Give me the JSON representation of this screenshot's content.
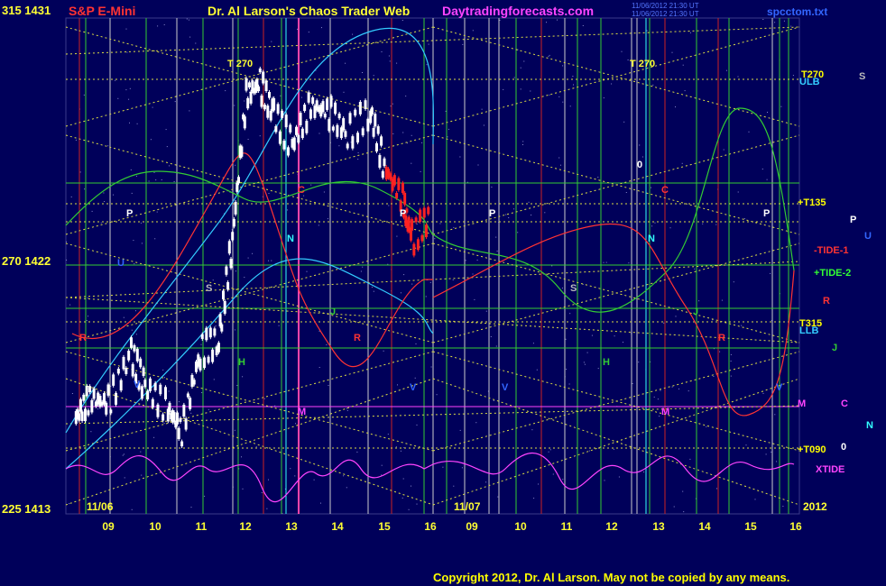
{
  "header": {
    "left_price": "315 1431",
    "symbol": "S&P E-Mini",
    "brand": "Dr. Al Larson's Chaos Trader Web",
    "site": "Daytradingforecasts.com",
    "stamp_1": "11/06/2012 21:30 UT",
    "stamp_2": "11/06/2012 21:30 UT",
    "file": "spcctom.txt"
  },
  "left_axis": {
    "top": "315 1431",
    "middle": "270 1422",
    "bottom": "225 1413"
  },
  "right_labels": [
    {
      "text": "T270",
      "color": "#ffff00"
    },
    {
      "text": "ULB",
      "color": "#33ccff"
    },
    {
      "text": "S",
      "color": "#bbbbbb"
    },
    {
      "text": "+T135",
      "color": "#ffff00"
    },
    {
      "text": "P",
      "color": "#ffffff"
    },
    {
      "text": "U",
      "color": "#3366ff"
    },
    {
      "text": "-TIDE-1",
      "color": "#ff3333"
    },
    {
      "text": "+TIDE-2",
      "color": "#33ff33"
    },
    {
      "text": "R",
      "color": "#ff3333"
    },
    {
      "text": "T315",
      "color": "#ffff00"
    },
    {
      "text": "LLB",
      "color": "#33ccff"
    },
    {
      "text": "J",
      "color": "#33cc33"
    },
    {
      "text": "M",
      "color": "#ff44ff"
    },
    {
      "text": "C",
      "color": "#ff44ff"
    },
    {
      "text": "N",
      "color": "#33ffff"
    },
    {
      "text": "+T090",
      "color": "#ffff00"
    },
    {
      "text": "0",
      "color": "#ffffff"
    },
    {
      "text": "XTIDE",
      "color": "#ff44ff"
    }
  ],
  "chart_labels": {
    "t270_a": "T   270",
    "t270_b": "T   270",
    "date_1": "11/06",
    "date_2": "11/07",
    "year": "2012"
  },
  "planet_labels": [
    {
      "text": "P",
      "color": "#ffffff"
    },
    {
      "text": "P",
      "color": "#ffffff"
    },
    {
      "text": "P",
      "color": "#ffffff"
    },
    {
      "text": "P",
      "color": "#ffffff"
    },
    {
      "text": "N",
      "color": "#33ffff"
    },
    {
      "text": "N",
      "color": "#33ffff"
    },
    {
      "text": "S",
      "color": "#bbbbbb"
    },
    {
      "text": "S",
      "color": "#bbbbbb"
    },
    {
      "text": "J",
      "color": "#33cc33"
    },
    {
      "text": "J",
      "color": "#33cc33"
    },
    {
      "text": "H",
      "color": "#33cc33"
    },
    {
      "text": "H",
      "color": "#33cc33"
    },
    {
      "text": "R",
      "color": "#ff3333"
    },
    {
      "text": "R",
      "color": "#ff3333"
    },
    {
      "text": "R",
      "color": "#ff3333"
    },
    {
      "text": "C",
      "color": "#ff3333"
    },
    {
      "text": "C",
      "color": "#ff3333"
    },
    {
      "text": "M",
      "color": "#ff44ff"
    },
    {
      "text": "M",
      "color": "#ff44ff"
    },
    {
      "text": "V",
      "color": "#3366ff"
    },
    {
      "text": "V",
      "color": "#3366ff"
    },
    {
      "text": "V",
      "color": "#3366ff"
    },
    {
      "text": "V",
      "color": "#3366ff"
    },
    {
      "text": "0",
      "color": "#ffffff"
    },
    {
      "text": "U",
      "color": "#3366ff"
    }
  ],
  "copyright": "Copyright 2012, Dr. Al Larson. May not be copied by any means.",
  "chart_data": {
    "type": "candlestick",
    "x_tick_labels": [
      "09",
      "10",
      "11",
      "12",
      "13",
      "14",
      "15",
      "16",
      "09",
      "10",
      "11",
      "12",
      "13",
      "14",
      "15",
      "16"
    ],
    "y_axis_labels": [
      "315 1431",
      "270 1422",
      "225 1413"
    ],
    "ylim": [
      1413,
      1431
    ],
    "price_series_approx": [
      {
        "x": 8.3,
        "y": 1416.5
      },
      {
        "x": 8.6,
        "y": 1417.2
      },
      {
        "x": 9.0,
        "y": 1417.0
      },
      {
        "x": 9.5,
        "y": 1418.8
      },
      {
        "x": 9.8,
        "y": 1417.6
      },
      {
        "x": 10.3,
        "y": 1416.8
      },
      {
        "x": 10.6,
        "y": 1416.0
      },
      {
        "x": 11.0,
        "y": 1418.9
      },
      {
        "x": 11.4,
        "y": 1419.3
      },
      {
        "x": 11.7,
        "y": 1423.0
      },
      {
        "x": 12.0,
        "y": 1428.2
      },
      {
        "x": 12.3,
        "y": 1428.6
      },
      {
        "x": 12.6,
        "y": 1427.5
      },
      {
        "x": 13.0,
        "y": 1426.4
      },
      {
        "x": 13.4,
        "y": 1427.8
      },
      {
        "x": 13.8,
        "y": 1427.6
      },
      {
        "x": 14.2,
        "y": 1426.8
      },
      {
        "x": 14.7,
        "y": 1427.6
      },
      {
        "x": 15.0,
        "y": 1425.6
      },
      {
        "x": 15.4,
        "y": 1424.4
      },
      {
        "x": 15.6,
        "y": 1423.0
      },
      {
        "x": 16.0,
        "y": 1423.8
      }
    ]
  },
  "colors": {
    "background": "#00005a",
    "price": "#ffffff",
    "price_down": "#ff2222",
    "fan_lines": "#dddd44",
    "title_red": "#ff3333",
    "title_yellow": "#ffff33",
    "title_magenta": "#ff44ff",
    "copyright": "#ffff00"
  }
}
